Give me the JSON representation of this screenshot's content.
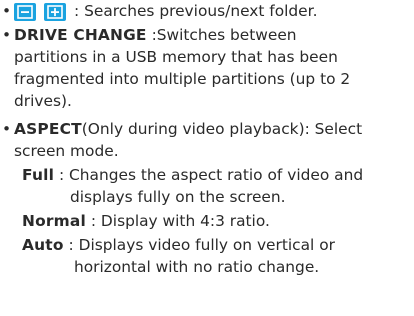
{
  "buttons": {
    "prev_icon": "minus-icon",
    "next_icon": "plus-icon",
    "accent": "#1aa3e0"
  },
  "folder_search": {
    "text": ": Searches previous/next folder."
  },
  "drive_change": {
    "title": "DRIVE CHANGE",
    "line1": ":Switches between",
    "line2": "partitions in a USB memory that has been",
    "line3": "fragmented into multiple partitions (up to 2",
    "line4": "drives)."
  },
  "aspect": {
    "title": "ASPECT",
    "line1": "(Only during video playback): Select",
    "line2": "screen mode.",
    "full": {
      "label": "Full",
      "line1": ": Changes the aspect ratio of video and",
      "line2": "displays fully on the screen."
    },
    "normal": {
      "label": "Normal",
      "line1": ": Display with 4:3 ratio."
    },
    "auto": {
      "label": "Auto",
      "line1": ": Displays video fully on vertical or",
      "line2": "horizontal with no ratio change."
    }
  }
}
